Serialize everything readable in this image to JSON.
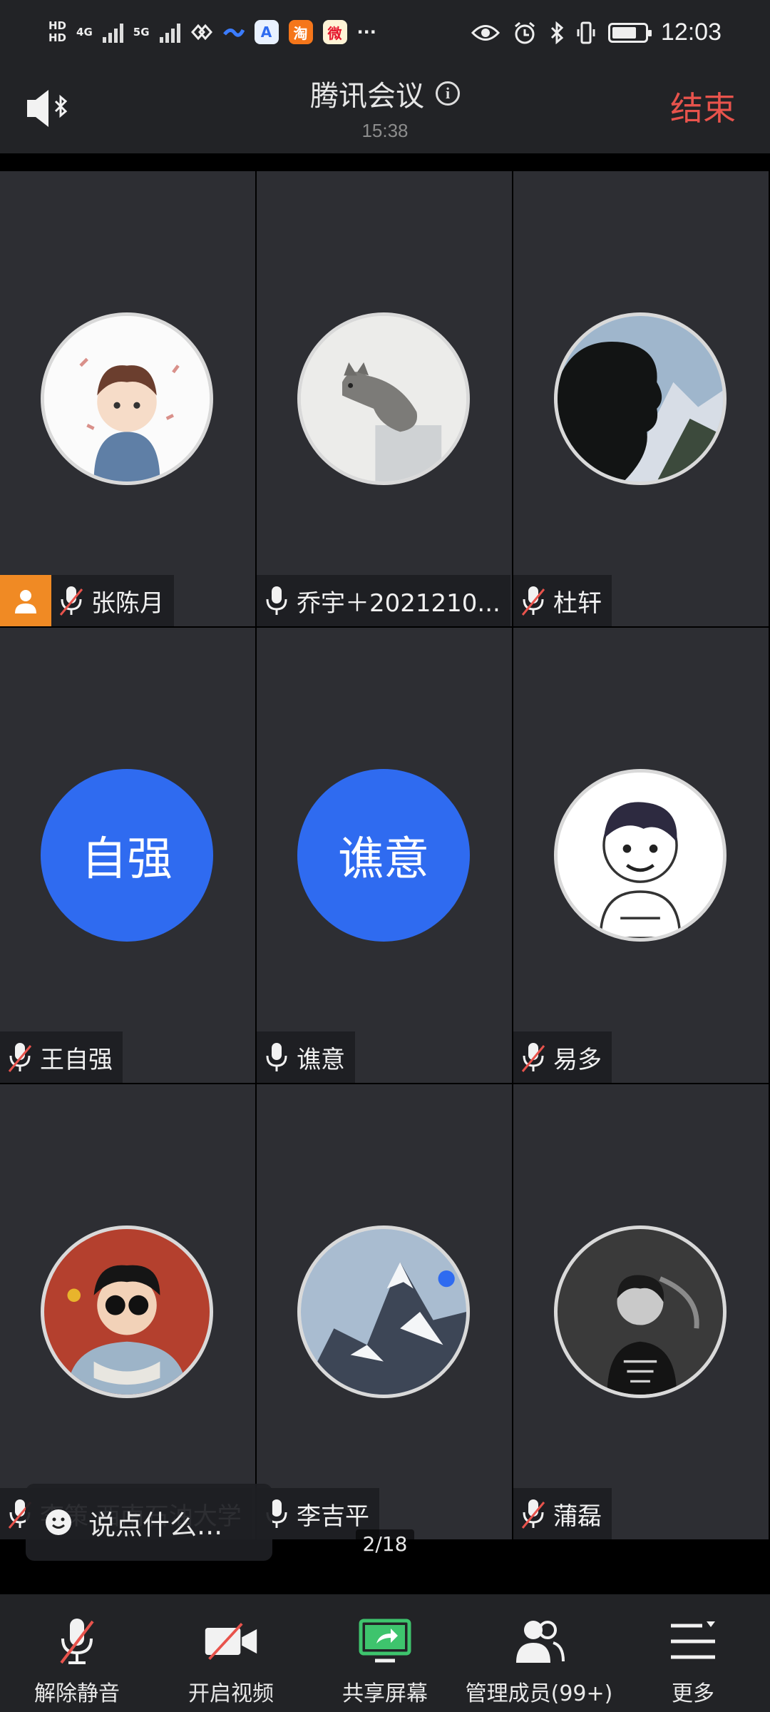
{
  "status_bar": {
    "net_labels": [
      "HD",
      "HD",
      "4G",
      "5G"
    ],
    "app_icons": [
      {
        "name": "taobao-icon",
        "glyph": "淘",
        "color": "#f5761a"
      },
      {
        "name": "weibo-icon",
        "glyph": "微",
        "color": "#e6162d"
      }
    ],
    "more": "···",
    "time": "12:03",
    "battery_level": 0.75
  },
  "header": {
    "title": "腾讯会议",
    "timer": "15:38",
    "end_label": "结束"
  },
  "participants": [
    {
      "name": "张陈月",
      "avatar": "cartoon-boy",
      "host": true,
      "muted": true
    },
    {
      "name": "乔宇＋2021210...",
      "avatar": "cat",
      "host": false,
      "muted": false
    },
    {
      "name": "杜轩",
      "avatar": "silhouette-mountain",
      "host": false,
      "muted": true
    },
    {
      "name": "王自强",
      "avatar_text": "自强",
      "host": false,
      "muted": true
    },
    {
      "name": "谯意",
      "avatar_text": "谯意",
      "host": false,
      "muted": false
    },
    {
      "name": "易多",
      "avatar": "sketch-boy",
      "host": false,
      "muted": true
    },
    {
      "name": "李策 西南石油大学",
      "avatar": "sunglasses-man",
      "host": false,
      "muted": true
    },
    {
      "name": "李吉平",
      "avatar": "snow-mountain",
      "host": false,
      "muted": false
    },
    {
      "name": "蒲磊",
      "avatar": "bw-photo",
      "host": false,
      "muted": true
    }
  ],
  "chat": {
    "placeholder": "说点什么..."
  },
  "pager": {
    "current": "2/18"
  },
  "toolbar": [
    {
      "label": "解除静音",
      "icon": "mic-off-icon"
    },
    {
      "label": "开启视频",
      "icon": "camera-off-icon"
    },
    {
      "label": "共享屏幕",
      "icon": "share-screen-icon"
    },
    {
      "label": "管理成员(99+)",
      "icon": "members-icon"
    },
    {
      "label": "更多",
      "icon": "more-menu-icon"
    }
  ],
  "colors": {
    "end": "#e8534c",
    "text_avatar": "#2f6bf0",
    "host": "#f08a24",
    "share": "#3ec46d"
  }
}
